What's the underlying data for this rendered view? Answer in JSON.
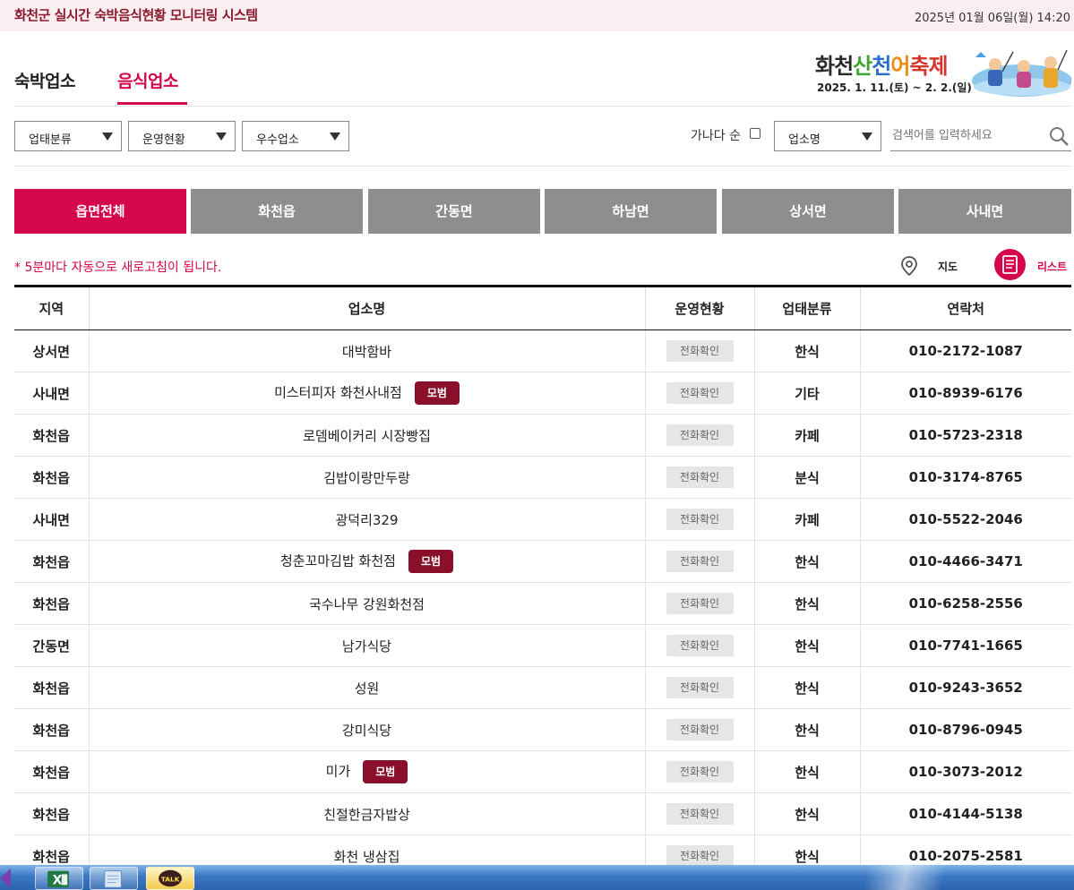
{
  "header": {
    "title": "화천군 실시간 숙박음식현황 모니터링 시스템",
    "datetime": "2025년 01월 06일(월) 14:20"
  },
  "main_tabs": [
    {
      "label": "숙박업소",
      "active": false
    },
    {
      "label": "음식업소",
      "active": true
    }
  ],
  "festival": {
    "title_parts": [
      "화천",
      "산",
      "천",
      "어",
      "축제"
    ],
    "date": "2025. 1. 11.(토) ~ 2. 2.(일)"
  },
  "filters": {
    "category": "업태분류",
    "status": "운영현황",
    "excellent": "우수업소",
    "sort_label": "가나다 순",
    "search_field": "업소명",
    "search_placeholder": "검색어를 입력하세요"
  },
  "region_tabs": [
    {
      "label": "읍면전체",
      "active": true
    },
    {
      "label": "화천읍",
      "active": false
    },
    {
      "label": "간동면",
      "active": false
    },
    {
      "label": "하남면",
      "active": false
    },
    {
      "label": "상서면",
      "active": false
    },
    {
      "label": "사내면",
      "active": false
    }
  ],
  "notice": "* 5분마다 자동으로 새로고침이 됩니다.",
  "view_toggle": {
    "map": "지도",
    "list": "리스트"
  },
  "table": {
    "headers": [
      "지역",
      "업소명",
      "운영현황",
      "업태분류",
      "연락처"
    ],
    "rows": [
      {
        "region": "상서면",
        "name": "대박함바",
        "badge": "",
        "status": "전화확인",
        "type": "한식",
        "phone": "010-2172-1087"
      },
      {
        "region": "사내면",
        "name": "미스터피자 화천사내점",
        "badge": "모범",
        "status": "전화확인",
        "type": "기타",
        "phone": "010-8939-6176"
      },
      {
        "region": "화천읍",
        "name": "로뎀베이커리 시장빵집",
        "badge": "",
        "status": "전화확인",
        "type": "카페",
        "phone": "010-5723-2318"
      },
      {
        "region": "화천읍",
        "name": "김밥이랑만두랑",
        "badge": "",
        "status": "전화확인",
        "type": "분식",
        "phone": "010-3174-8765"
      },
      {
        "region": "사내면",
        "name": "광덕리329",
        "badge": "",
        "status": "전화확인",
        "type": "카페",
        "phone": "010-5522-2046"
      },
      {
        "region": "화천읍",
        "name": "청춘꼬마김밥 화천점",
        "badge": "모범",
        "status": "전화확인",
        "type": "한식",
        "phone": "010-4466-3471"
      },
      {
        "region": "화천읍",
        "name": "국수나무 강원화천점",
        "badge": "",
        "status": "전화확인",
        "type": "한식",
        "phone": "010-6258-2556"
      },
      {
        "region": "간동면",
        "name": "남가식당",
        "badge": "",
        "status": "전화확인",
        "type": "한식",
        "phone": "010-7741-1665"
      },
      {
        "region": "화천읍",
        "name": "성원",
        "badge": "",
        "status": "전화확인",
        "type": "한식",
        "phone": "010-9243-3652"
      },
      {
        "region": "화천읍",
        "name": "강미식당",
        "badge": "",
        "status": "전화확인",
        "type": "한식",
        "phone": "010-8796-0945"
      },
      {
        "region": "화천읍",
        "name": "미가",
        "badge": "모범",
        "status": "전화확인",
        "type": "한식",
        "phone": "010-3073-2012"
      },
      {
        "region": "화천읍",
        "name": "친절한금자밥상",
        "badge": "",
        "status": "전화확인",
        "type": "한식",
        "phone": "010-4144-5138"
      },
      {
        "region": "화천읍",
        "name": "화천 냉삼집",
        "badge": "",
        "status": "전화확인",
        "type": "한식",
        "phone": "010-2075-2581"
      }
    ]
  },
  "taskbar": {
    "items": [
      {
        "icon": "excel-icon"
      },
      {
        "icon": "notepad-icon"
      },
      {
        "icon": "kakaotalk-icon",
        "label": "TALK"
      }
    ]
  },
  "colors": {
    "accent": "#d6064a",
    "badge": "#8a0f2a",
    "tab_inactive": "#8e8e8e"
  }
}
